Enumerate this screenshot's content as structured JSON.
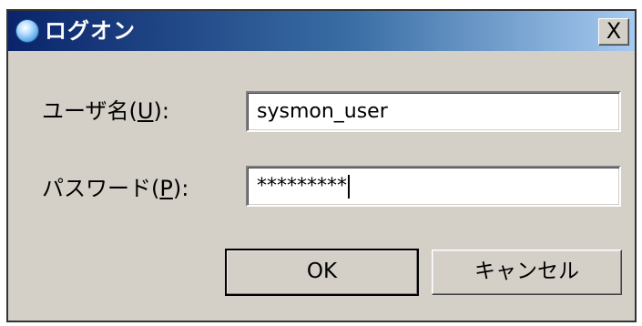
{
  "window": {
    "title": "ログオン",
    "close_label": "X"
  },
  "fields": {
    "username": {
      "label_prefix": "ユーザ名(",
      "mnemonic": "U",
      "label_suffix": "):",
      "value": "sysmon_user"
    },
    "password": {
      "label_prefix": "パスワード(",
      "mnemonic": "P",
      "label_suffix": "):",
      "value": "*********"
    }
  },
  "buttons": {
    "ok": "OK",
    "cancel": "キャンセル"
  },
  "icons": {
    "app": "globe-icon",
    "close": "close-icon"
  }
}
